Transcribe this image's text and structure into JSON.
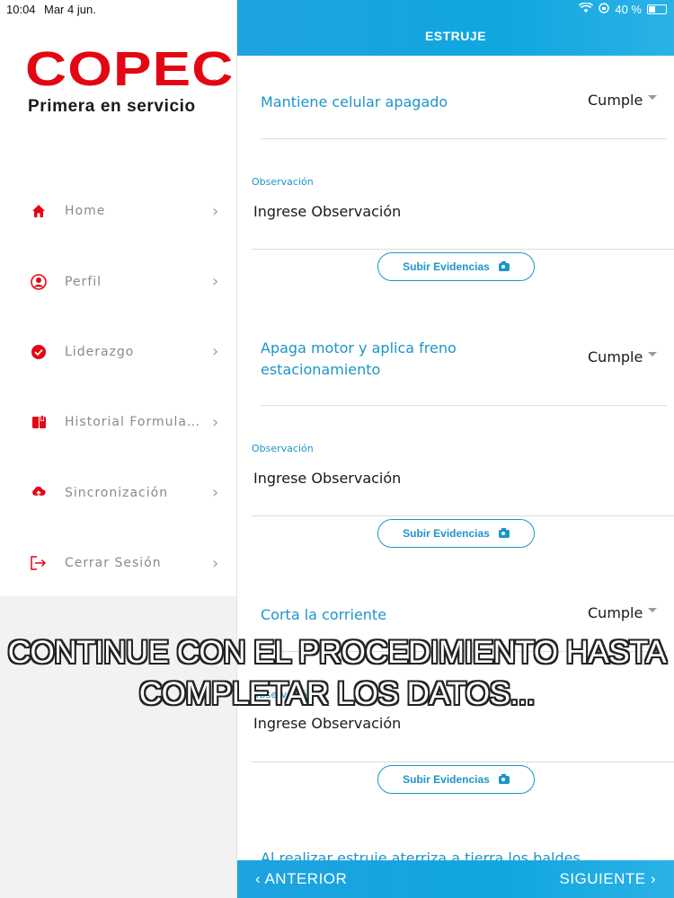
{
  "status_bar": {
    "time": "10:04",
    "date": "Mar 4 jun.",
    "battery": "40 %"
  },
  "brand": {
    "logo_text": "COPEC",
    "tagline": "Primera en servicio"
  },
  "sidebar": {
    "items": [
      {
        "label": "Home",
        "icon": "home-icon"
      },
      {
        "label": "Perfil",
        "icon": "user-icon"
      },
      {
        "label": "Liderazgo",
        "icon": "check-icon"
      },
      {
        "label": "Historial Formularios",
        "icon": "book-icon"
      },
      {
        "label": "Sincronización",
        "icon": "cloud-upload-icon"
      },
      {
        "label": "Cerrar Sesión",
        "icon": "logout-icon"
      }
    ]
  },
  "header": {
    "title": "ESTRUJE"
  },
  "questions": [
    {
      "text": "Mantiene celular apagado",
      "value": "Cumple",
      "obs_label": "Observación",
      "obs_placeholder": "Ingrese Observación",
      "evidence_label": "Subir Evidencias"
    },
    {
      "text": "Apaga motor y aplica freno estacionamiento",
      "value": "Cumple",
      "obs_label": "Observación",
      "obs_placeholder": "Ingrese Observación",
      "evidence_label": "Subir Evidencias"
    },
    {
      "text": "Corta la corriente",
      "value": "Cumple",
      "obs_label": "Observación",
      "obs_placeholder": "Ingrese Observación",
      "evidence_label": "Subir Evidencias"
    }
  ],
  "next_question_partial": "Al realizar estruje aterriza a tierra los baldes",
  "footer": {
    "prev_label": "ANTERIOR",
    "next_label": "SIGUIENTE"
  },
  "overlay_caption": {
    "line1": "CONTINUE CON EL PROCEDIMIENTO HASTA",
    "line2": "COMPLETAR LOS DATOS..."
  },
  "colors": {
    "brand_red": "#e30613",
    "accent_blue": "#1c95c9",
    "bar_blue": "#10a6df"
  }
}
